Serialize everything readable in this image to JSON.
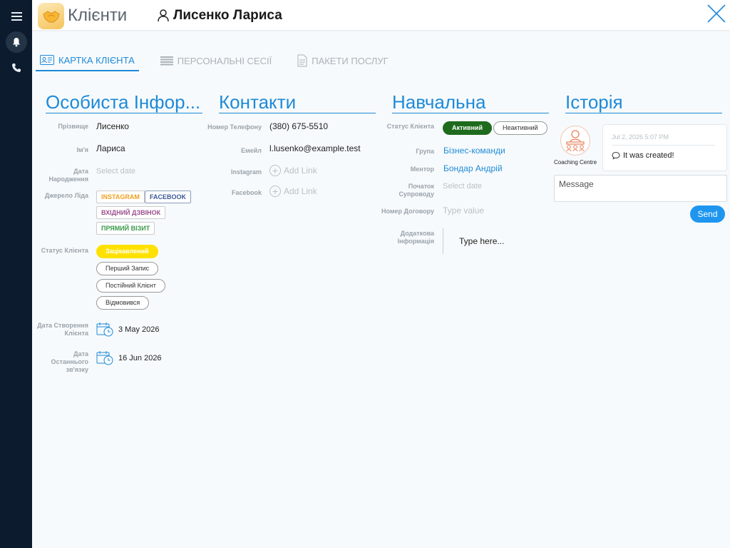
{
  "header": {
    "app_title": "Клієнти",
    "client_name": "Лисенко Лариса"
  },
  "tabs": [
    {
      "label": "КАРТКА КЛІЄНТА",
      "active": true
    },
    {
      "label": "ПЕРСОНАЛЬНІ СЕСІЇ",
      "active": false
    },
    {
      "label": "ПАКЕТИ ПОСЛУГ",
      "active": false
    }
  ],
  "personal": {
    "title": "Особиста Інфор...",
    "surname_label": "Прізвище",
    "surname": "Лисенко",
    "name_label": "Ім'я",
    "name": "Лариса",
    "birthdate_label_1": "Дата",
    "birthdate_label_2": "Народження",
    "birthdate_placeholder": "Select date",
    "lead_source_label": "Джерело Ліда",
    "lead_sources": [
      "INSTAGRAM",
      "FACEBOOK",
      "ВХІДНИЙ ДЗВІНОК",
      "ПРЯМИЙ ВІЗИТ"
    ],
    "status_label": "Статус Клієнта",
    "statuses": [
      "Зацікавлений",
      "Перший Запис",
      "Постійний Клієнт",
      "Відмовився"
    ],
    "selected_status": "Зацікавлений",
    "created_label_1": "Дата Створення",
    "created_label_2": "Клієнта",
    "created_date": "3 May 2026",
    "last_contact_label_1": "Дата Останнього",
    "last_contact_label_2": "зв'язку",
    "last_contact_date": "16 Jun 2026"
  },
  "contacts": {
    "title": "Контакти",
    "phone_label": "Номер Телефону",
    "phone": "(380) 675-5510",
    "email_label": "Емейл",
    "email": "l.lusenko@example.test",
    "instagram_label": "Instagram",
    "facebook_label": "Facebook",
    "add_link": "Add Link"
  },
  "education": {
    "title": "Навчальна",
    "status_label": "Статус Клієнта",
    "active_label": "Активний",
    "inactive_label": "Неактивний",
    "group_label": "Група",
    "group": "Бізнес-команди",
    "mentor_label": "Ментор",
    "mentor": "Бондар Андрій",
    "start_label_1": "Початок",
    "start_label_2": "Супроводу",
    "start_placeholder": "Select date",
    "contract_label": "Номер Договору",
    "contract_placeholder": "Type value",
    "extra_label_1": "Додаткова",
    "extra_label_2": "Інформація",
    "extra_placeholder": "Type here..."
  },
  "history": {
    "title": "Історія",
    "author": "Coaching Centre",
    "time": "Jul 2, 2026 5:07 PM",
    "text": "It was created!",
    "message_placeholder": "Message",
    "send_label": "Send"
  },
  "colors": {
    "accent": "#1e8ad8",
    "rail": "#0c1c2e",
    "status_selected": "#ffe100",
    "active_green": "#1e6b1e",
    "instagram": "#f0a020",
    "facebook": "#3b5998",
    "incoming_call": "#9b4e8f",
    "direct_visit": "#3a9a4a"
  }
}
